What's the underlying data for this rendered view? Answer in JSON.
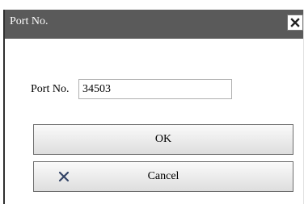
{
  "dialog": {
    "title": "Port No.",
    "close_icon": "close-icon"
  },
  "form": {
    "port_label": "Port No.",
    "port_value": "34503"
  },
  "buttons": {
    "ok_label": "OK",
    "cancel_label": "Cancel",
    "cancel_icon": "x-icon"
  },
  "colors": {
    "titlebar": "#5a5a5a",
    "title_text": "#ffffff",
    "cancel_icon": "#334466"
  }
}
